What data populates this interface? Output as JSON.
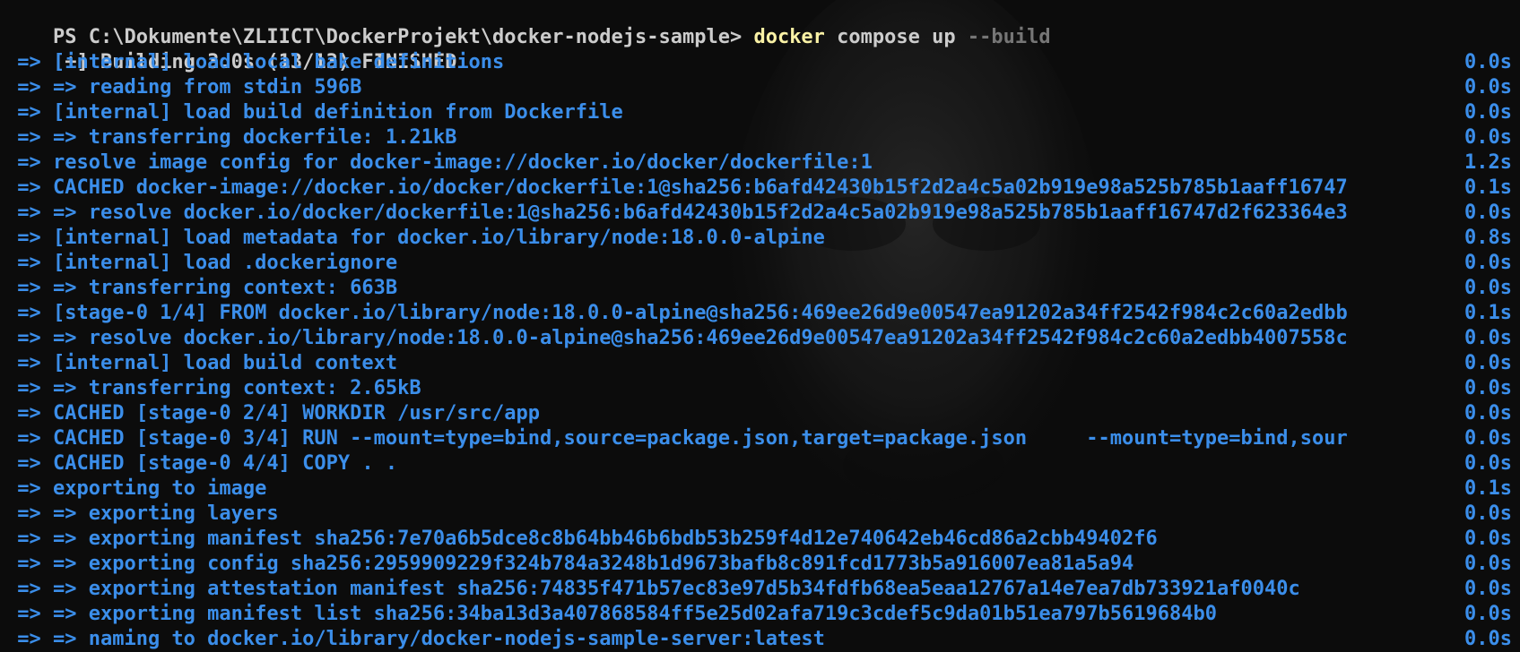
{
  "terminal": {
    "prompt": {
      "path": "PS C:\\Dokumente\\ZLIICT\\DockerProjekt\\docker-nodejs-sample> ",
      "command": "docker",
      "args": " compose up ",
      "flag": "--build"
    },
    "header": "[+] Building 3.0s (13/13) FINISHED",
    "steps": [
      {
        "text": " => [internal] load local bake definitions",
        "time": "0.0s"
      },
      {
        "text": " => => reading from stdin 596B",
        "time": "0.0s"
      },
      {
        "text": " => [internal] load build definition from Dockerfile",
        "time": "0.0s"
      },
      {
        "text": " => => transferring dockerfile: 1.21kB",
        "time": "0.0s"
      },
      {
        "text": " => resolve image config for docker-image://docker.io/docker/dockerfile:1",
        "time": "1.2s"
      },
      {
        "text": " => CACHED docker-image://docker.io/docker/dockerfile:1@sha256:b6afd42430b15f2d2a4c5a02b919e98a525b785b1aaff16747",
        "time": "0.1s"
      },
      {
        "text": " => => resolve docker.io/docker/dockerfile:1@sha256:b6afd42430b15f2d2a4c5a02b919e98a525b785b1aaff16747d2f623364e3",
        "time": "0.0s"
      },
      {
        "text": " => [internal] load metadata for docker.io/library/node:18.0.0-alpine",
        "time": "0.8s"
      },
      {
        "text": " => [internal] load .dockerignore",
        "time": "0.0s"
      },
      {
        "text": " => => transferring context: 663B",
        "time": "0.0s"
      },
      {
        "text": " => [stage-0 1/4] FROM docker.io/library/node:18.0.0-alpine@sha256:469ee26d9e00547ea91202a34ff2542f984c2c60a2edbb",
        "time": "0.1s"
      },
      {
        "text": " => => resolve docker.io/library/node:18.0.0-alpine@sha256:469ee26d9e00547ea91202a34ff2542f984c2c60a2edbb4007558c",
        "time": "0.0s"
      },
      {
        "text": " => [internal] load build context",
        "time": "0.0s"
      },
      {
        "text": " => => transferring context: 2.65kB",
        "time": "0.0s"
      },
      {
        "text": " => CACHED [stage-0 2/4] WORKDIR /usr/src/app",
        "time": "0.0s"
      },
      {
        "text": " => CACHED [stage-0 3/4] RUN --mount=type=bind,source=package.json,target=package.json     --mount=type=bind,sour",
        "time": "0.0s"
      },
      {
        "text": " => CACHED [stage-0 4/4] COPY . .",
        "time": "0.0s"
      },
      {
        "text": " => exporting to image",
        "time": "0.1s"
      },
      {
        "text": " => => exporting layers",
        "time": "0.0s"
      },
      {
        "text": " => => exporting manifest sha256:7e70a6b5dce8c8b64bb46b6bdb53b259f4d12e740642eb46cd86a2cbb49402f6",
        "time": "0.0s"
      },
      {
        "text": " => => exporting config sha256:2959909229f324b784a3248b1d9673bafb8c891fcd1773b5a916007ea81a5a94",
        "time": "0.0s"
      },
      {
        "text": " => => exporting attestation manifest sha256:74835f471b57ec83e97d5b34fdfb68ea5eaa12767a14e7ea7db733921af0040c",
        "time": "0.0s"
      },
      {
        "text": " => => exporting manifest list sha256:34ba13d3a407868584ff5e25d02afa719c3cdef5c9da01b51ea797b5619684b0",
        "time": "0.0s"
      },
      {
        "text": " => => naming to docker.io/library/docker-nodejs-sample-server:latest",
        "time": "0.0s"
      }
    ]
  },
  "colors": {
    "background": "#0c0c0c",
    "text": "#cccccc",
    "command": "#f9f1a5",
    "step": "#3b8eea",
    "flag": "#767676"
  },
  "background_art": "word-portrait-watermark"
}
